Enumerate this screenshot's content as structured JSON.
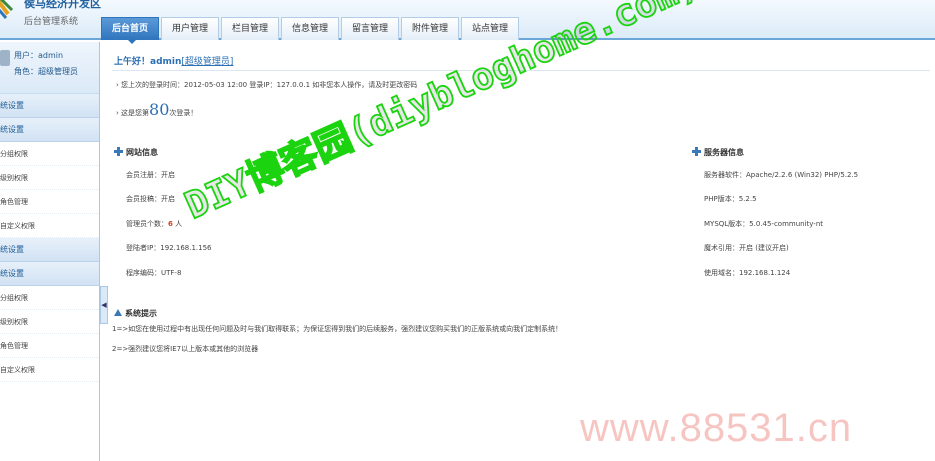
{
  "header": {
    "site_title": "侯马经济开发区",
    "site_subtitle": "后台管理系统",
    "tabs": [
      {
        "label": "后台首页",
        "active": true
      },
      {
        "label": "用户管理"
      },
      {
        "label": "栏目管理"
      },
      {
        "label": "信息管理"
      },
      {
        "label": "留言管理"
      },
      {
        "label": "附件管理"
      },
      {
        "label": "站点管理"
      }
    ]
  },
  "sidebar": {
    "user_line": "用户：admin",
    "role_line": "角色：超级管理员",
    "groups": [
      {
        "section": "统设置"
      },
      {
        "section": "统设置",
        "items": [
          "分组权限",
          "级别权限",
          "角色管理",
          "自定义权限"
        ]
      },
      {
        "section": "统设置"
      },
      {
        "section": "统设置",
        "items": [
          "分组权限",
          "级别权限",
          "角色管理",
          "自定义权限"
        ]
      }
    ],
    "toggle_glyph": "◀"
  },
  "main": {
    "greeting": "上午好！admin",
    "greeting_link": "[超级管理员]",
    "last_login": "您上次的登录时间：2012-05-03 12:00 登录IP：127.0.0.1     如非您本人操作，请及时更改密码",
    "visit_prefix": "这是您第",
    "visit_count": "80",
    "visit_suffix": "次登录！",
    "site_info": {
      "title": "网站信息",
      "rows": [
        {
          "text": "会员注册：开启"
        },
        {
          "text": "会员投稿：开启"
        },
        {
          "label": "管理员个数：",
          "value": "6",
          "unit": "人"
        },
        {
          "text": "登陆者IP：192.168.1.156"
        },
        {
          "text": "程序编码：UTF-8"
        }
      ]
    },
    "server_info": {
      "title": "服务器信息",
      "rows": [
        "服务器软件：Apache/2.2.6 (Win32) PHP/5.2.5",
        "PHP版本：5.2.5",
        "MYSQL版本：5.0.45-community-nt",
        "魔术引用：开启 (建议开启)",
        "使用域名：192.168.1.124"
      ]
    },
    "tips": {
      "title": "系统提示",
      "lines": [
        "1=>如您在使用过程中有出现任何问题及时与我们取得联系；为保证您得到我们的后续服务，强烈建议您购买我们的正版系统或向我们定制系统！",
        "2=>强烈建议您将IE7以上版本或其他的浏览器"
      ]
    }
  },
  "watermarks": {
    "main": "DIY博客园(diybloghome.com)",
    "url": "www.88531.cn"
  }
}
